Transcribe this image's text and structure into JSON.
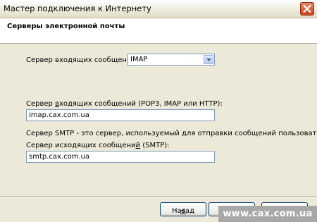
{
  "window": {
    "title": "Мастер подключения к Интернету"
  },
  "header": {
    "title": "Серверы электронной почты"
  },
  "incoming_type": {
    "label": "Сервер входящих сообщений:",
    "selected": "IMAP"
  },
  "incoming_server": {
    "label_pre": "Сервер ",
    "label_u": "в",
    "label_post": "ходящих сообщений (POP3, IMAP или HTTP):",
    "value": "imap.cax.com.ua"
  },
  "smtp_note": "Сервер SMTP - это сервер, используемый для отправки сообщений  пользователя.",
  "outgoing_server": {
    "label_pre": "Сервер исходящих сообщени",
    "label_u": "й",
    "label_post": " (SMTP):",
    "value": "smtp.cax.com.ua"
  },
  "footer": {
    "back_u": "<",
    "back_post": " Назад",
    "watermark": "www.cax.com.ua"
  }
}
